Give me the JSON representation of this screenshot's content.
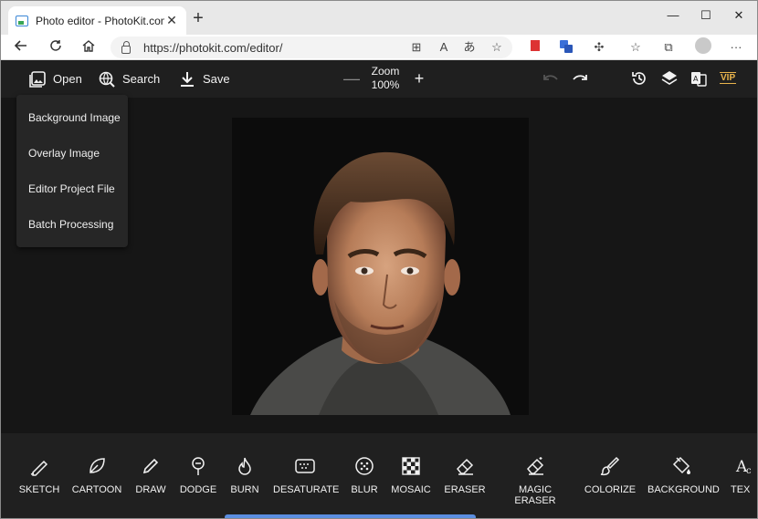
{
  "browser": {
    "tab_title": "Photo editor - PhotoKit.com",
    "url": "https://photokit.com/editor/"
  },
  "toolbar": {
    "open_label": "Open",
    "search_label": "Search",
    "save_label": "Save",
    "zoom_label": "Zoom",
    "zoom_value": "100%",
    "vip_label": "VIP"
  },
  "open_menu": {
    "items": [
      "Background Image",
      "Overlay Image",
      "Editor Project File",
      "Batch Processing"
    ]
  },
  "tools": [
    {
      "label": "SKETCH",
      "icon": "pencil-sketch-icon"
    },
    {
      "label": "CARTOON",
      "icon": "leaf-icon"
    },
    {
      "label": "DRAW",
      "icon": "pen-icon"
    },
    {
      "label": "DODGE",
      "icon": "dodge-icon"
    },
    {
      "label": "BURN",
      "icon": "flame-icon"
    },
    {
      "label": "DESATURATE",
      "icon": "desaturate-icon"
    },
    {
      "label": "BLUR",
      "icon": "blur-icon"
    },
    {
      "label": "MOSAIC",
      "icon": "mosaic-icon"
    },
    {
      "label": "ERASER",
      "icon": "eraser-icon"
    },
    {
      "label": "MAGIC ERASER",
      "icon": "magic-eraser-icon"
    },
    {
      "label": "COLORIZE",
      "icon": "colorize-brush-icon"
    },
    {
      "label": "BACKGROUND",
      "icon": "paint-bucket-icon"
    },
    {
      "label": "TEX",
      "icon": "text-icon"
    }
  ],
  "colors": {
    "app_bg": "#1b1b1b",
    "vip": "#e9b44c",
    "scrollbar": "#5b8ee0"
  }
}
